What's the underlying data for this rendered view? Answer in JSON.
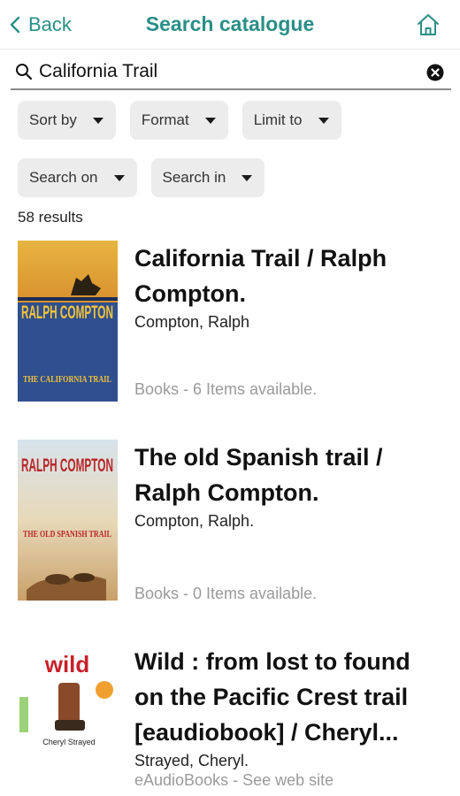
{
  "nav": {
    "back_label": "Back",
    "title": "Search catalogue"
  },
  "search": {
    "value": "California Trail"
  },
  "filters": {
    "sort_by": "Sort by",
    "format": "Format",
    "limit_to": "Limit to",
    "search_on": "Search on",
    "search_in": "Search in"
  },
  "results_count": "58 results",
  "results": [
    {
      "title": "California Trail / Ralph Compton.",
      "author": "Compton, Ralph",
      "availability": "Books - 6 Items available.",
      "cover_author": "RALPH COMPTON",
      "cover_title": "THE CALIFORNIA TRAIL"
    },
    {
      "title": "The old Spanish trail / Ralph Compton.",
      "author": "Compton, Ralph.",
      "availability": "Books - 0 Items available.",
      "cover_author": "RALPH COMPTON",
      "cover_title": "THE OLD SPANISH TRAIL"
    },
    {
      "title": "Wild : from lost to found on the Pacific Crest trail [eaudiobook] / Cheryl...",
      "author": "Strayed, Cheryl.",
      "availability": "eAudioBooks - See web site",
      "cover_title": "wild",
      "cover_author": "Cheryl Strayed"
    }
  ],
  "colors": {
    "accent": "#2a8f86",
    "filter_bg": "#ececec",
    "muted_text": "#9a9a9a"
  },
  "icons": {
    "back": "chevron-left-icon",
    "home": "home-icon",
    "search": "magnifier-icon",
    "clear": "clear-circle-icon"
  }
}
